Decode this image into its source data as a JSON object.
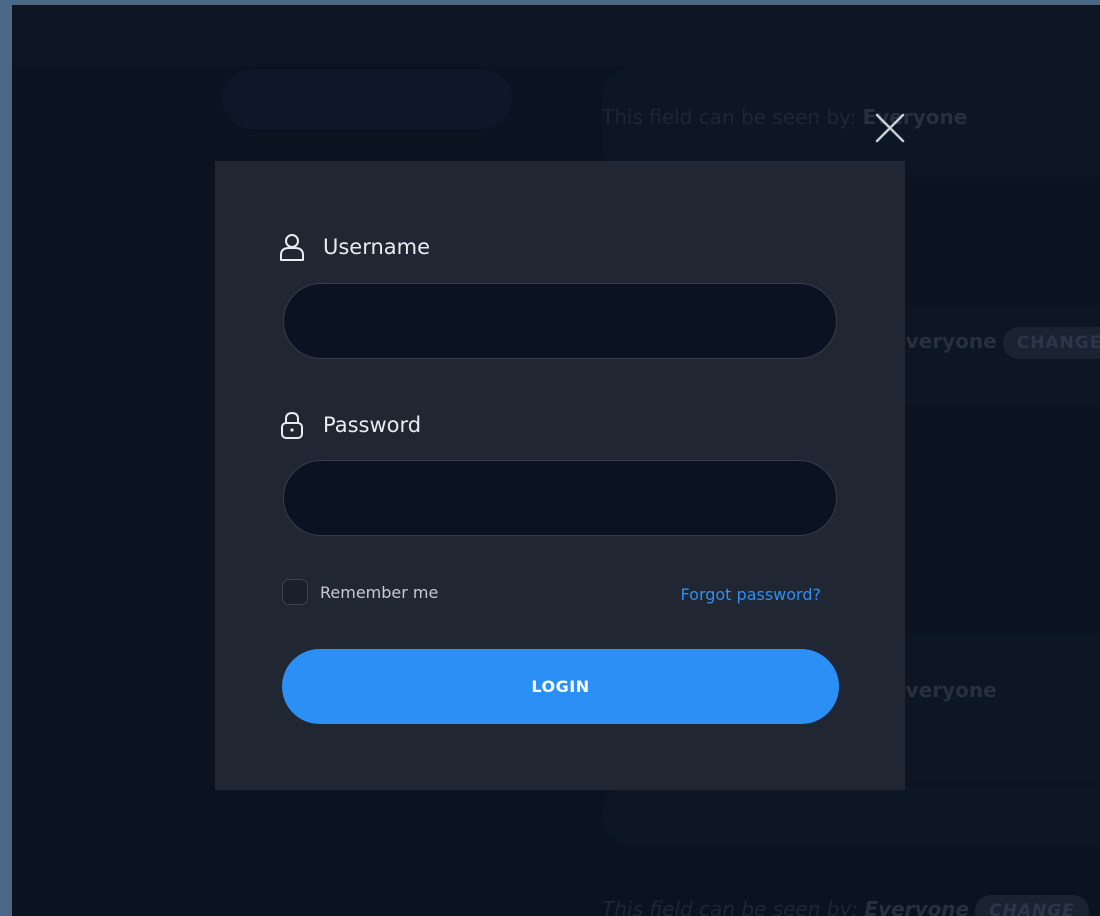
{
  "background": {
    "row_1_prefix": "This field can be seen by: ",
    "row_1_value": "Everyone",
    "row_2_value": "Everyone",
    "row_2_button": "CHANGE",
    "row_3_value": "Everyone",
    "row_4_prefix": "This field can be seen by: ",
    "row_4_value": "Everyone",
    "row_4_button": "CHANGE"
  },
  "login_modal": {
    "close_icon": "close-icon",
    "username": {
      "label": "Username",
      "icon": "user-icon",
      "value": "",
      "placeholder": ""
    },
    "password": {
      "label": "Password",
      "icon": "lock-icon",
      "value": "",
      "placeholder": ""
    },
    "remember_label": "Remember me",
    "remember_checked": false,
    "forgot_label": "Forgot password?",
    "login_label": "LOGIN"
  },
  "colors": {
    "accent": "#2b8ff6",
    "modal_bg": "#202632",
    "page_bg": "#0b1320",
    "frame_bg": "#4a6786",
    "input_bg": "#0b1221"
  }
}
